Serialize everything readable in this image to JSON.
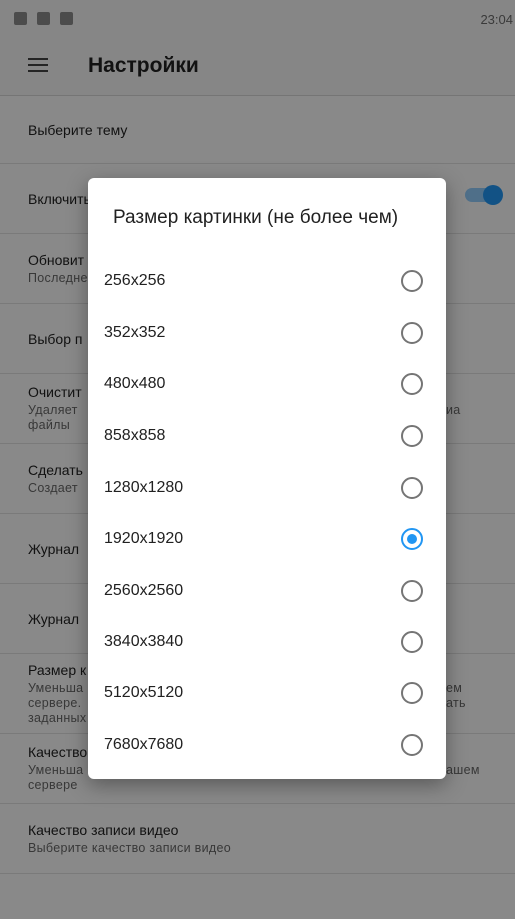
{
  "status": {
    "time": "23:04"
  },
  "appbar": {
    "title": "Настройки"
  },
  "settings": [
    {
      "title": "Выберите тему",
      "sub": ""
    },
    {
      "title": "Включить",
      "sub": ""
    },
    {
      "title": "Обновит",
      "sub": "Последне"
    },
    {
      "title": "Выбор п",
      "sub": ""
    },
    {
      "title": "Очистит",
      "sub": "Удаляет ",
      "sub_right": "иа",
      "sub2": "файлы"
    },
    {
      "title": "Сделать",
      "sub": "Создает"
    },
    {
      "title": "Журнал",
      "sub": ""
    },
    {
      "title": "Журнал",
      "sub": ""
    },
    {
      "title": "Размер к",
      "sub": "Уменьша",
      "sub_right": "ем",
      "sub2": "сервере.",
      "sub2_right": "ать",
      "sub3": "заданных"
    },
    {
      "title": "Качество",
      "sub": "Уменьша",
      "sub_right": "ашем",
      "sub2": "сервере"
    },
    {
      "title": "Качество записи видео",
      "sub": "Выберите качество записи видео"
    }
  ],
  "dialog": {
    "title": "Размер картинки (не более чем)",
    "options": [
      "256x256",
      "352x352",
      "480x480",
      "858x858",
      "1280x1280",
      "1920x1920",
      "2560x2560",
      "3840x3840",
      "5120x5120",
      "7680x7680"
    ],
    "selected": "1920x1920"
  },
  "colors": {
    "accent": "#2196f3",
    "toggle_track": "#90caf9"
  }
}
